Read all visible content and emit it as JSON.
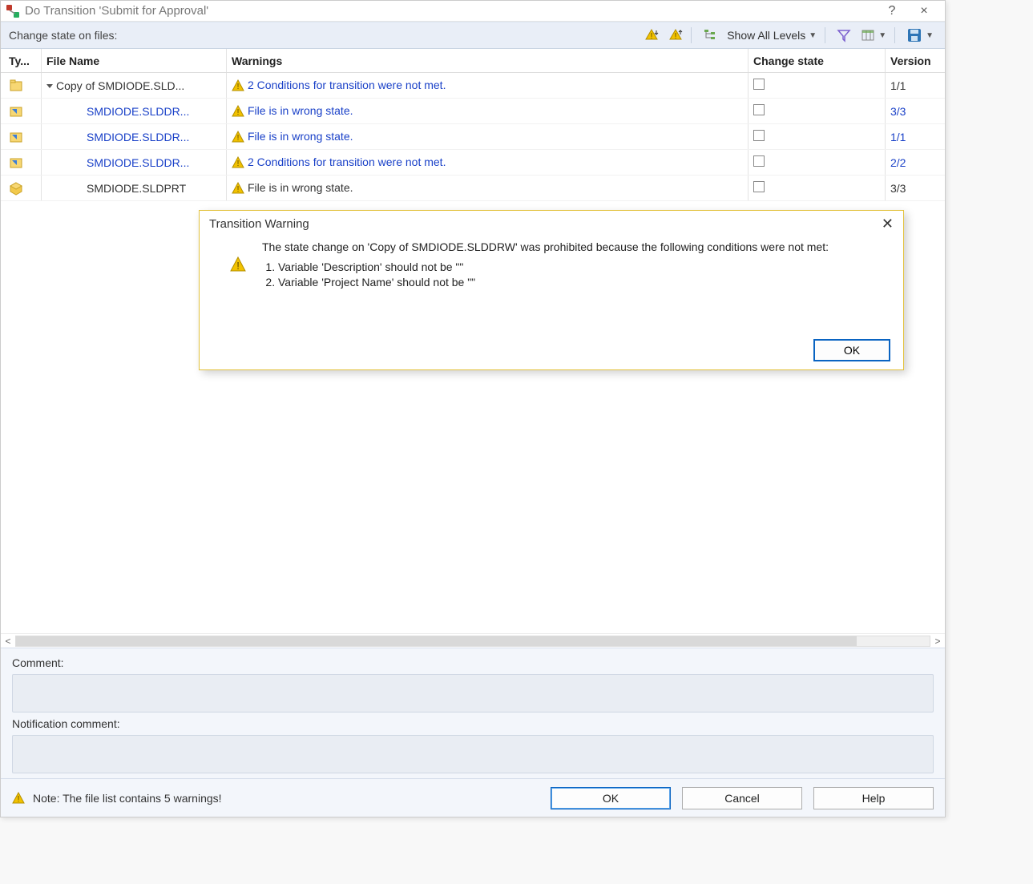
{
  "window": {
    "title": "Do Transition 'Submit for Approval'",
    "help_tooltip": "?",
    "close_tooltip": "×"
  },
  "toolbar": {
    "label": "Change state on files:",
    "show_all_levels": "Show All Levels"
  },
  "columns": {
    "type": "Ty...",
    "file_name": "File Name",
    "warnings": "Warnings",
    "change_state": "Change state",
    "version": "Version"
  },
  "rows": [
    {
      "icon": "assembly",
      "indent": 0,
      "expand": true,
      "name": "Copy of SMDIODE.SLD...",
      "link": false,
      "warn": "2 Conditions for transition were not met.",
      "warn_link": true,
      "checked": false,
      "version": "1/1",
      "ver_link": false
    },
    {
      "icon": "drawing",
      "indent": 1,
      "expand": false,
      "name": "SMDIODE.SLDDR...",
      "link": true,
      "warn": "File is in wrong state.",
      "warn_link": true,
      "checked": false,
      "version": "3/3",
      "ver_link": true
    },
    {
      "icon": "drawing",
      "indent": 1,
      "expand": false,
      "name": "SMDIODE.SLDDR...",
      "link": true,
      "warn": "File is in wrong state.",
      "warn_link": true,
      "checked": false,
      "version": "1/1",
      "ver_link": true
    },
    {
      "icon": "drawing",
      "indent": 1,
      "expand": false,
      "name": "SMDIODE.SLDDR...",
      "link": true,
      "warn": "2 Conditions for transition were not met.",
      "warn_link": true,
      "checked": false,
      "version": "2/2",
      "ver_link": true
    },
    {
      "icon": "part",
      "indent": 1,
      "expand": false,
      "name": "SMDIODE.SLDPRT",
      "link": false,
      "warn": "File is in wrong state.",
      "warn_link": false,
      "checked": false,
      "version": "3/3",
      "ver_link": false
    }
  ],
  "comments": {
    "comment_label": "Comment:",
    "comment_value": "",
    "notification_label": "Notification comment:",
    "notification_value": ""
  },
  "statusbar": {
    "note": "Note: The file list contains 5 warnings!",
    "ok": "OK",
    "cancel": "Cancel",
    "help": "Help"
  },
  "modal": {
    "title": "Transition Warning",
    "message": "The state change on 'Copy of SMDIODE.SLDDRW' was prohibited because the following conditions were not met:",
    "items": [
      "Variable 'Description' should not be \"\"",
      "Variable 'Project Name' should not be \"\""
    ],
    "ok": "OK"
  }
}
